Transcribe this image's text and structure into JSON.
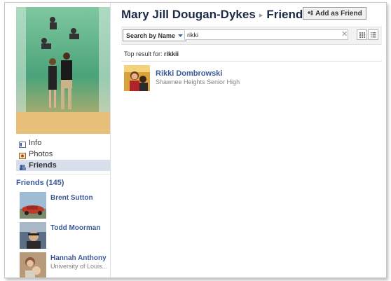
{
  "profile": {
    "name": "Mary Jill Dougan-Dykes",
    "section": "Friends",
    "separator": "▸",
    "add_friend_label": "Add as Friend"
  },
  "nav": {
    "items": [
      {
        "label": "Info",
        "icon": "info-icon"
      },
      {
        "label": "Photos",
        "icon": "photos-icon"
      },
      {
        "label": "Friends",
        "icon": "friends-icon",
        "active": true
      }
    ]
  },
  "friends_box": {
    "header": "Friends (145)",
    "items": [
      {
        "name": "Brent Sutton",
        "sub": ""
      },
      {
        "name": "Todd Moorman",
        "sub": ""
      },
      {
        "name": "Hannah Anthony",
        "sub": "University of Louis..."
      }
    ]
  },
  "search": {
    "mode_label": "Search by Name",
    "query": "rikki",
    "clear_label": "✕"
  },
  "results": {
    "top_result_prefix": "Top result for:",
    "top_result_term": "rikkii",
    "items": [
      {
        "name": "Rikki Dombrowski",
        "sub": "Shawnee Heights Senior High"
      }
    ]
  },
  "colors": {
    "link": "#3b5998",
    "title": "#1c2a47",
    "nav_active": "#d8dfea"
  }
}
